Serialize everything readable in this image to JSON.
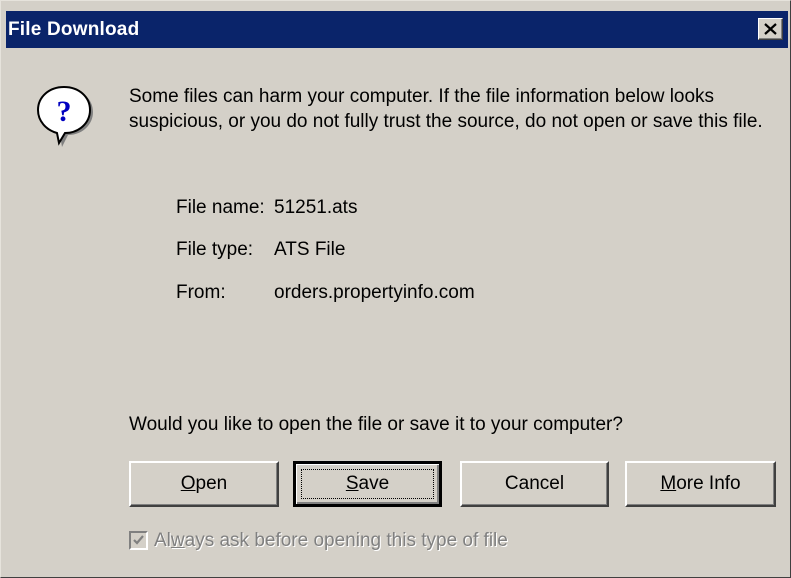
{
  "dialog": {
    "title": "File Download",
    "close_icon": "close-icon",
    "icon": "question-bubble-icon",
    "warning": "Some files can harm your computer. If the file information below looks suspicious, or you do not fully trust the source, do not open or save this file.",
    "file_info": {
      "name_label": "File name:",
      "name_value": "51251.ats",
      "type_label": "File type:",
      "type_value": "ATS File",
      "from_label": "From:",
      "from_value": "orders.propertyinfo.com"
    },
    "prompt": "Would you like to open the file or save it to your computer?",
    "buttons": {
      "open": {
        "pre": "",
        "key": "O",
        "post": "pen"
      },
      "save": {
        "pre": "",
        "key": "S",
        "post": "ave"
      },
      "cancel": {
        "pre": "Cancel",
        "key": "",
        "post": ""
      },
      "more_info": {
        "pre": "",
        "key": "M",
        "post": "ore Info"
      }
    },
    "always_ask": {
      "pre": "Al",
      "key": "w",
      "post": "ays ask before opening this type of file",
      "checked": true,
      "enabled": false
    },
    "colors": {
      "face": "#d4d0c8",
      "titlebar": "#0a246a",
      "disabled_text": "#808080"
    }
  }
}
